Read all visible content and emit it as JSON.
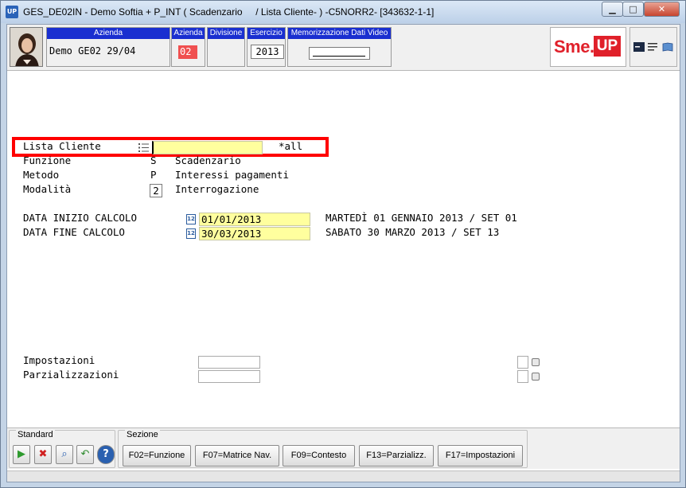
{
  "window": {
    "title": "GES_DE02IN - Demo Softia + P_INT ( Scadenzario     / Lista Cliente- ) -C5NORR2- [343632-1-1]",
    "app_icon": "UP",
    "min_glyph": "▁",
    "max_glyph": "□",
    "close_glyph": "✕"
  },
  "header": {
    "azienda_label": "Azienda",
    "azienda_value": "Demo GE02 29/04",
    "azienda_code_label": "Azienda",
    "azienda_code": "02",
    "divisione_label": "Divisione",
    "esercizio_label": "Esercizio",
    "esercizio_value": "2013",
    "memorizzazione_label": "Memorizzazione Dati Video",
    "logo_sme": "Sme.",
    "logo_up": "UP"
  },
  "form": {
    "lista_cliente_label": "Lista Cliente",
    "lista_cliente_value": "",
    "lista_cliente_all": "*all",
    "funzione_label": "Funzione",
    "funzione_code": "S",
    "funzione_desc": "Scadenzario",
    "metodo_label": "Metodo",
    "metodo_code": "P",
    "metodo_desc": "Interessi pagamenti",
    "modalita_label": "Modalità",
    "modalita_code": "2",
    "modalita_desc": "Interrogazione",
    "data_inizio_label": "DATA INIZIO CALCOLO",
    "data_inizio_value": "01/01/2013",
    "data_inizio_desc": "MARTEDÌ 01 GENNAIO 2013 / SET 01",
    "data_fine_label": "DATA FINE CALCOLO",
    "data_fine_value": "30/03/2013",
    "data_fine_desc": "SABATO 30 MARZO 2013 / SET 13",
    "calendar_icon_text": "12",
    "impostazioni_label": "Impostazioni",
    "parzializzazioni_label": "Parzializzazioni"
  },
  "footer": {
    "standard_title": "Standard",
    "sezione_title": "Sezione",
    "icons": [
      "play-icon",
      "cancel-icon",
      "search-icon",
      "back-icon",
      "help-icon"
    ],
    "icon_glyphs": {
      "play": "▶",
      "cancel": "✖",
      "search": "⌕",
      "back": "↶",
      "help": "?"
    },
    "buttons": [
      "F02=Funzione",
      "F07=Matrice Nav.",
      "F09=Contesto",
      "F13=Parzializz.",
      "F17=Impostazioni"
    ]
  }
}
